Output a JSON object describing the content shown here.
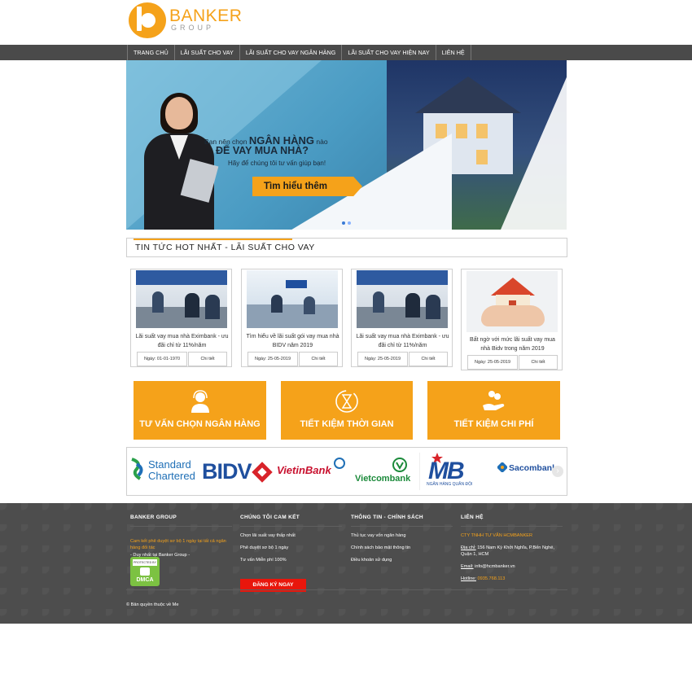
{
  "logo": {
    "name": "BANKER",
    "sub": "GROUP"
  },
  "nav": {
    "items": [
      {
        "label": "TRANG CHỦ"
      },
      {
        "label": "LÃI SUẤT CHO VAY"
      },
      {
        "label": "LÃI SUẤT CHO VAY NGÂN HÀNG"
      },
      {
        "label": "LÃI SUẤT CHO VAY HIỆN NAY"
      },
      {
        "label": "LIÊN HỆ"
      }
    ]
  },
  "banner": {
    "line1_prefix": "Bạn nên chọn",
    "line1_bold": "NGÂN HÀNG",
    "line1_suffix": "nào",
    "line2": "ĐỂ VAY MUA NHÀ?",
    "line3": "Hãy để chúng tôi tư vấn giúp bạn!",
    "cta": "Tìm hiểu thêm"
  },
  "news_section": {
    "title": "TIN TỨC HOT NHẤT - LÃI SUẤT CHO VAY"
  },
  "news": [
    {
      "title": "Lãi suất vay mua nhà Eximbank - ưu đãi chỉ từ 11%/năm",
      "date": "Ngày: 01-01-1970",
      "more": "Chi tiết"
    },
    {
      "title": "Tìm hiểu về lãi suất gói vay mua nhà BIDV năm 2019",
      "date": "Ngày: 25-05-2019",
      "more": "Chi tiết"
    },
    {
      "title": "Lãi suất vay mua nhà Eximbank - ưu đãi chỉ từ 11%/năm",
      "date": "Ngày: 25-05-2019",
      "more": "Chi tiết"
    },
    {
      "title": "Bất ngờ với mức lãi suất vay mua nhà Bidv trong năm 2019",
      "date": "Ngày: 25-05-2019",
      "more": "Chi tiết"
    }
  ],
  "features": [
    {
      "label": "TƯ VẤN CHỌN NGÂN HÀNG",
      "icon": "headset-icon"
    },
    {
      "label": "TIẾT KIỆM THỜI GIAN",
      "icon": "hourglass-icon"
    },
    {
      "label": "TIẾT KIỆM CHI PHÍ",
      "icon": "money-hand-icon"
    }
  ],
  "banks": [
    {
      "name": "Standard Chartered",
      "line1": "Standard",
      "line2": "Chartered"
    },
    {
      "name": "BIDV"
    },
    {
      "name": "VietinBank"
    },
    {
      "name": "Vietcombank"
    },
    {
      "name": "MB",
      "sub": "NGÂN HÀNG QUÂN ĐỘI"
    },
    {
      "name": "Sacombank"
    }
  ],
  "footer": {
    "col1": {
      "title": "BANKER GROUP",
      "text1": "Cam kết phê duyệt sơ bộ 1 ngày tại tất cả ngân hàng đối tác",
      "text2": "- Duy nhất tại Banker Group -",
      "dmca_top": "PROTECTED BY",
      "dmca": "DMCA"
    },
    "col2": {
      "title": "CHÚNG TÔI CAM KẾT",
      "items": [
        "Chọn lãi suất vay thấp nhất",
        "Phê duyệt sơ bộ 1 ngày",
        "Tư vấn Miễn phí 100%"
      ],
      "button": "ĐĂNG KÝ NGAY"
    },
    "col3": {
      "title": "THÔNG TIN - CHÍNH SÁCH",
      "items": [
        "Thủ tục vay vốn ngân hàng",
        "Chính sách bảo mật thông tin",
        "Điều khoản sử dụng"
      ]
    },
    "col4": {
      "title": "LIÊN HỆ",
      "company": "CTY TNHH TƯ VẤN HCMBANKER",
      "addr_label": "Địa chỉ:",
      "addr": "156 Nam Kỳ Khởi Nghĩa, P.Bến Nghé, Quận 1, HCM",
      "email_label": "Email:",
      "email": "info@hcmbanker.vn",
      "hotline_label": "Hotline:",
      "hotline": "0935.768.113"
    },
    "copyright": "© Bản quyền thuộc về Me"
  },
  "colors": {
    "accent": "#f5a21a",
    "nav_bg": "#4a4a4a",
    "footer_bg": "#4d4d4d",
    "register": "#e8160c"
  }
}
